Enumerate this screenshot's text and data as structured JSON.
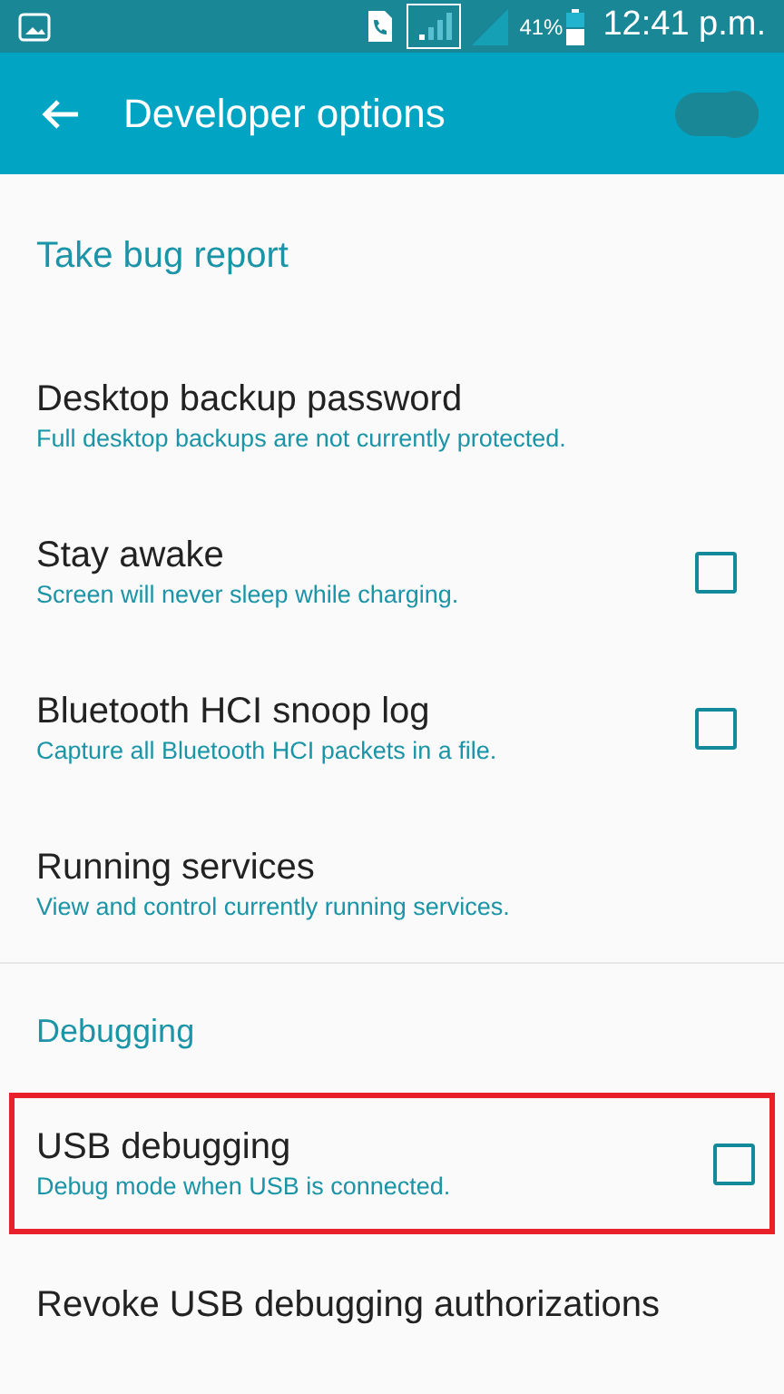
{
  "status_bar": {
    "battery": "41%",
    "time": "12:41 p.m."
  },
  "toolbar": {
    "title": "Developer options",
    "master_switch": {
      "on": true
    }
  },
  "items": [
    {
      "kind": "accent",
      "title": "Take bug report"
    },
    {
      "kind": "setting",
      "title": "Desktop backup password",
      "summary": "Full desktop backups are not currently protected."
    },
    {
      "kind": "checkbox",
      "title": "Stay awake",
      "summary": "Screen will never sleep while charging.",
      "checked": false
    },
    {
      "kind": "checkbox",
      "title": "Bluetooth HCI snoop log",
      "summary": "Capture all Bluetooth HCI packets in a file.",
      "checked": false
    },
    {
      "kind": "setting",
      "title": "Running services",
      "summary": "View and control currently running services."
    },
    {
      "kind": "category",
      "title": "Debugging"
    },
    {
      "kind": "checkbox",
      "title": "USB debugging",
      "summary": "Debug mode when USB is connected.",
      "checked": false,
      "highlighted": true
    },
    {
      "kind": "setting",
      "title": "Revoke USB debugging authorizations"
    }
  ]
}
